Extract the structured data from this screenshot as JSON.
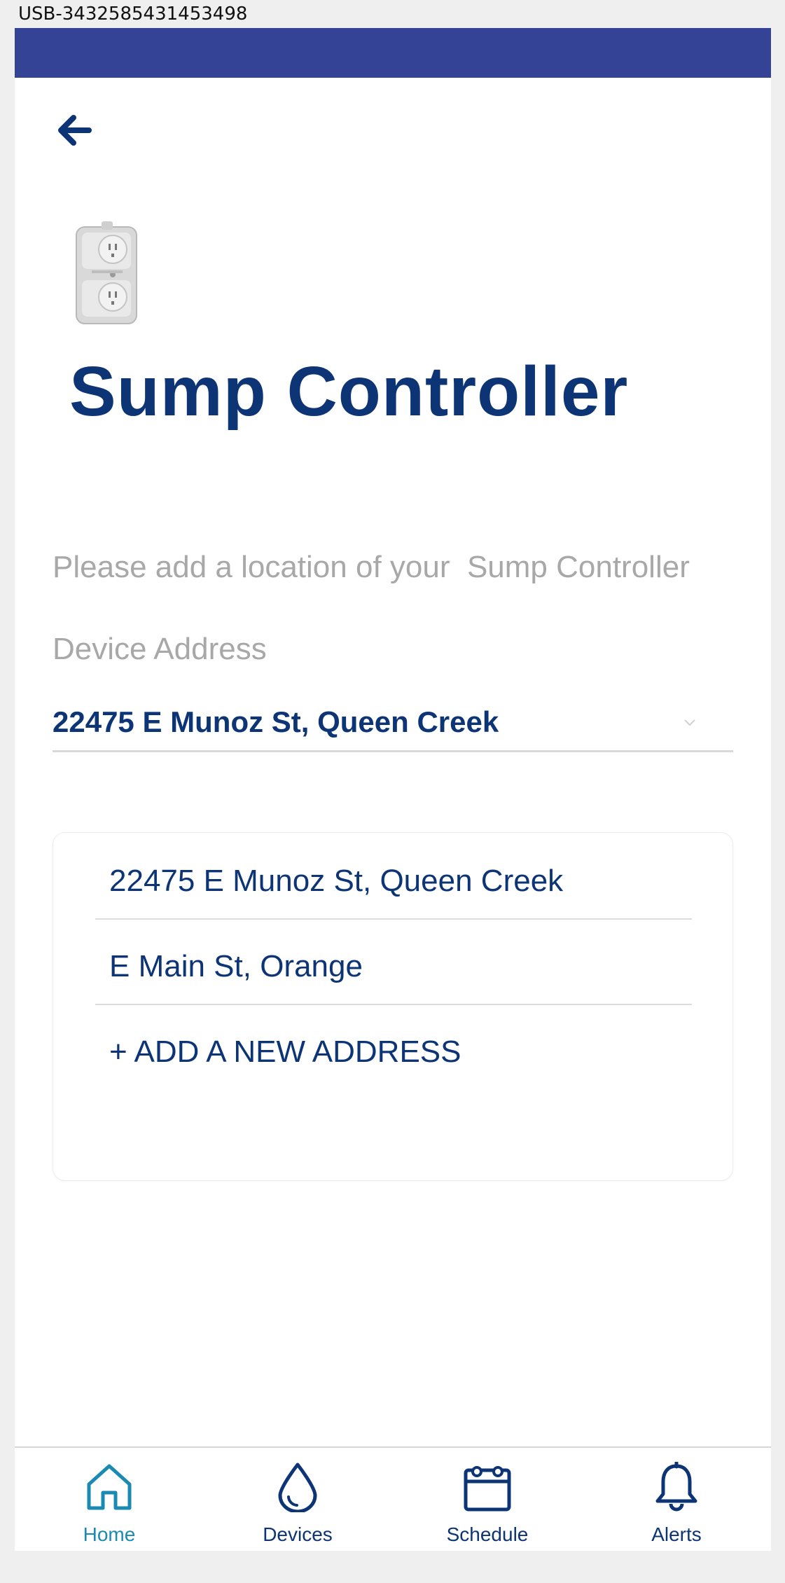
{
  "device_id": "USB-3432585431453498",
  "header": {
    "title": "Sump Controller"
  },
  "form": {
    "prompt": "Please add a location of your  Sump Controller",
    "address_label": "Device Address",
    "selected_address": "22475 E Munoz St, Queen Creek"
  },
  "dropdown": {
    "options": [
      {
        "label": "22475 E Munoz St, Queen Creek"
      },
      {
        "label": "E Main St, Orange"
      },
      {
        "label": "+ ADD A NEW ADDRESS"
      }
    ]
  },
  "bottom_nav": {
    "items": [
      {
        "label": "Home",
        "icon": "home-icon",
        "active": true
      },
      {
        "label": "Devices",
        "icon": "water-drop-icon",
        "active": false
      },
      {
        "label": "Schedule",
        "icon": "calendar-icon",
        "active": false
      },
      {
        "label": "Alerts",
        "icon": "bell-icon",
        "active": false
      }
    ]
  },
  "colors": {
    "status_bar": "#344395",
    "primary_text": "#0d3576",
    "muted_text": "#a8a8a8",
    "active_nav": "#1b8ab3"
  }
}
